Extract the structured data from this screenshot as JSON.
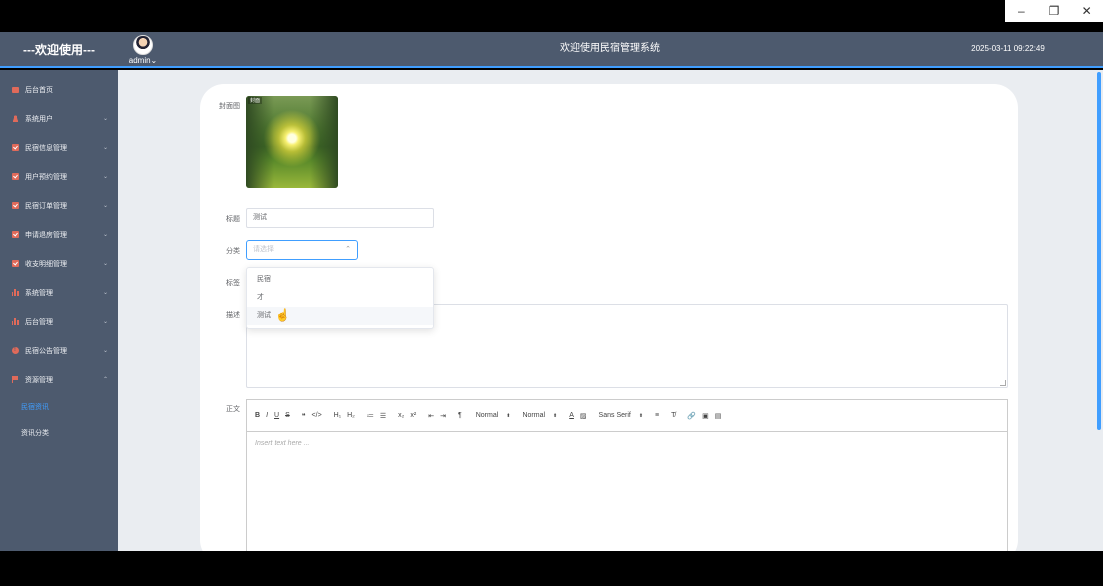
{
  "window": {
    "controls": [
      "–",
      "❐",
      "✕"
    ]
  },
  "header": {
    "brand": "---欢迎使用---",
    "username": "admin",
    "user_caret": "⌄",
    "title": "欢迎使用民宿管理系统",
    "datetime": "2025-03-11 09:22:49"
  },
  "sidebar": {
    "items": [
      {
        "label": "后台首页",
        "icon": "message-icon",
        "chevron": ""
      },
      {
        "label": "系统用户",
        "icon": "person-icon",
        "chevron": "⌄"
      },
      {
        "label": "民宿信息管理",
        "icon": "check-icon",
        "chevron": "⌄"
      },
      {
        "label": "用户预约管理",
        "icon": "check-icon",
        "chevron": "⌄"
      },
      {
        "label": "民宿订单管理",
        "icon": "check-icon",
        "chevron": "⌄"
      },
      {
        "label": "申请退房管理",
        "icon": "check-icon",
        "chevron": "⌄"
      },
      {
        "label": "收支明细管理",
        "icon": "check-icon",
        "chevron": "⌄"
      },
      {
        "label": "系统管理",
        "icon": "chart-icon",
        "chevron": "⌄"
      },
      {
        "label": "后台管理",
        "icon": "chart-icon",
        "chevron": "⌄"
      },
      {
        "label": "民宿公告管理",
        "icon": "info-icon",
        "chevron": "⌄"
      },
      {
        "label": "资源管理",
        "icon": "flag-icon",
        "chevron": "⌃"
      }
    ],
    "subitems": [
      {
        "label": "民宿资讯",
        "active": true
      },
      {
        "label": "资讯分类",
        "active": false
      }
    ]
  },
  "form": {
    "cover_label": "封面图",
    "cover_badge": "封面",
    "title_label": "标题",
    "title_value": "测试",
    "category_label": "分类",
    "category_placeholder": "请选择",
    "category_arrow": "⌃",
    "category_options": [
      "民宿",
      "才",
      "测试"
    ],
    "tags_label": "标签",
    "desc_label": "描述",
    "content_label": "正文"
  },
  "editor": {
    "tools": [
      "B",
      "I",
      "U",
      "S",
      "❝",
      "</>",
      "H₁",
      "H₂",
      "≔",
      "☰",
      "x₂",
      "x²",
      "⇤",
      "⇥",
      "¶"
    ],
    "size_select": "Normal",
    "header_select": "Normal",
    "font_select": "Sans Serif",
    "tools2": [
      "A",
      "▨",
      "≡",
      "T̸",
      "🔗",
      "▣",
      "▤"
    ],
    "placeholder": "Insert text here ..."
  },
  "colors": {
    "sidebar_bg": "#4d5a6e",
    "accent": "#409eff",
    "icon": "#e06a5a"
  }
}
